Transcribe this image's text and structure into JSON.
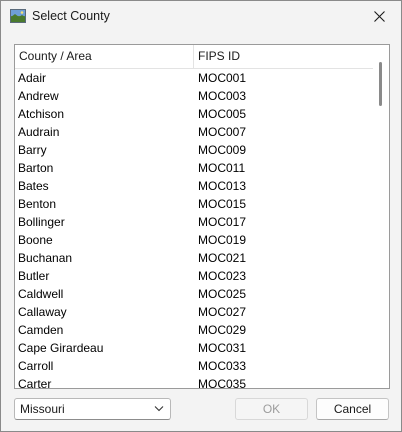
{
  "window": {
    "title": "Select County",
    "icon": "landscape-picture-icon"
  },
  "list": {
    "columns": {
      "county": "County / Area",
      "fips": "FIPS ID"
    },
    "rows": [
      {
        "county": "Adair",
        "fips": "MOC001"
      },
      {
        "county": "Andrew",
        "fips": "MOC003"
      },
      {
        "county": "Atchison",
        "fips": "MOC005"
      },
      {
        "county": "Audrain",
        "fips": "MOC007"
      },
      {
        "county": "Barry",
        "fips": "MOC009"
      },
      {
        "county": "Barton",
        "fips": "MOC011"
      },
      {
        "county": "Bates",
        "fips": "MOC013"
      },
      {
        "county": "Benton",
        "fips": "MOC015"
      },
      {
        "county": "Bollinger",
        "fips": "MOC017"
      },
      {
        "county": "Boone",
        "fips": "MOC019"
      },
      {
        "county": "Buchanan",
        "fips": "MOC021"
      },
      {
        "county": "Butler",
        "fips": "MOC023"
      },
      {
        "county": "Caldwell",
        "fips": "MOC025"
      },
      {
        "county": "Callaway",
        "fips": "MOC027"
      },
      {
        "county": "Camden",
        "fips": "MOC029"
      },
      {
        "county": "Cape Girardeau",
        "fips": "MOC031"
      },
      {
        "county": "Carroll",
        "fips": "MOC033"
      },
      {
        "county": "Carter",
        "fips": "MOC035"
      }
    ]
  },
  "footer": {
    "state_select": {
      "value": "Missouri"
    },
    "ok_label": "OK",
    "cancel_label": "Cancel"
  },
  "colors": {
    "background": "#f0f0f0",
    "list_background": "#ffffff",
    "disabled_text": "#9c9c9c"
  }
}
